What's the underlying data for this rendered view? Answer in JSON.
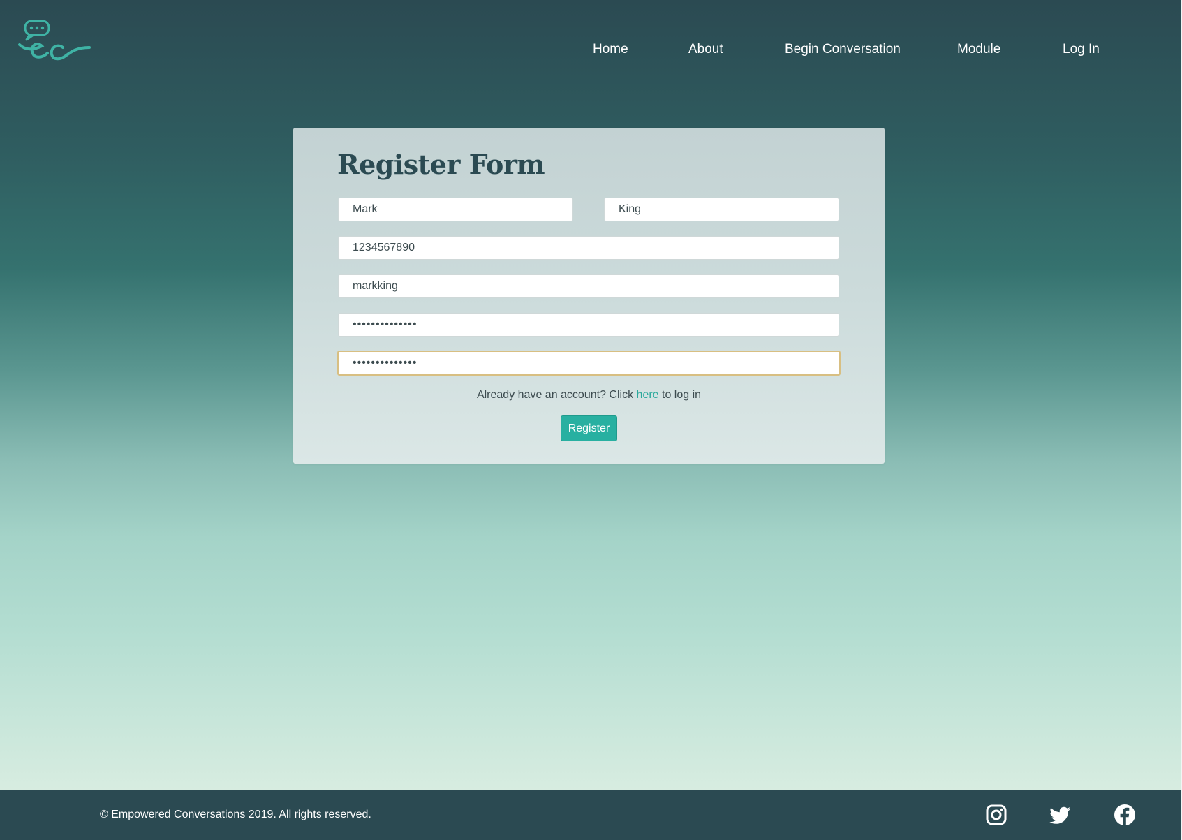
{
  "header": {
    "logo_icon": "empowered-conversations-logo",
    "nav": [
      {
        "label": "Home"
      },
      {
        "label": "About"
      },
      {
        "label": "Begin Conversation"
      },
      {
        "label": "Module"
      },
      {
        "label": "Log In"
      }
    ]
  },
  "form": {
    "title": "Register Form",
    "first_name": "Mark",
    "last_name": "King",
    "phone": "1234567890",
    "username": "markking",
    "password": "••••••••••••••",
    "confirm_password": "••••••••••••••",
    "account_prefix": "Already have an account? Click ",
    "account_link": "here",
    "account_suffix": " to log in",
    "register_label": "Register"
  },
  "footer": {
    "copyright": "© Empowered Conversations 2019. All rights reserved.",
    "social_icons": [
      "instagram-icon",
      "twitter-icon",
      "facebook-icon"
    ]
  },
  "colors": {
    "brand_dark": "#2b4a52",
    "accent_teal": "#28b0a1",
    "focus_border": "#d8bf82"
  }
}
